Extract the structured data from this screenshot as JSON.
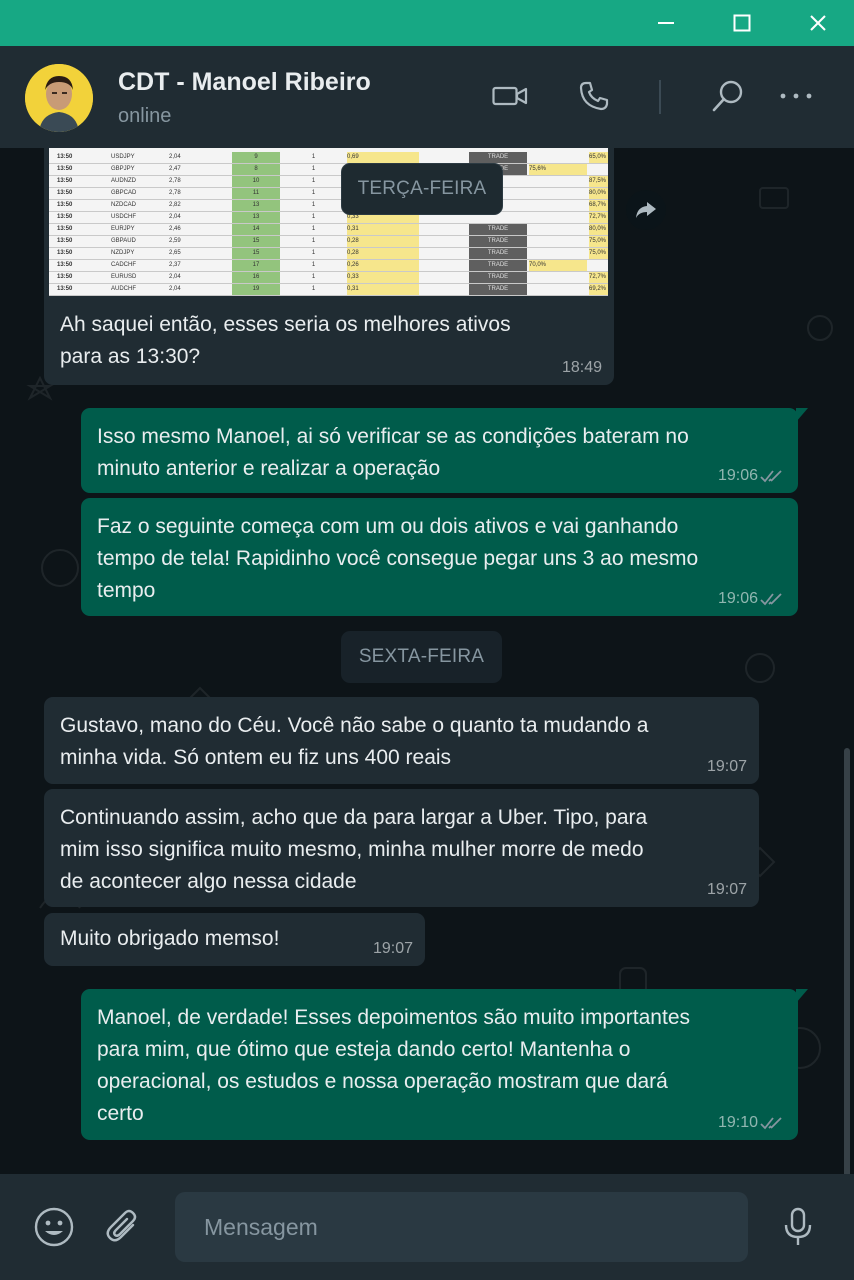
{
  "window": {
    "controls": [
      "minimize-icon",
      "maximize-icon",
      "close-icon"
    ],
    "accent_color": "#17a884"
  },
  "header": {
    "contact_name": "CDT - Manoel Ribeiro",
    "status": "online",
    "icons": [
      "video-call-icon",
      "phone-icon",
      "search-icon",
      "menu-dots-icon"
    ]
  },
  "chat": {
    "colors": {
      "incoming_bg": "#202c33",
      "outgoing_bg": "#005c4b",
      "background": "#0d1418"
    },
    "image_message": {
      "caption_line_1": "Ah saquei então, esses seria os melhores ativos",
      "caption_line_2": "para as 13:30?",
      "time": "18:49",
      "sheet_rows": [
        {
          "time": "13:50",
          "asset": "USDJPY",
          "val": "2,04",
          "n": "9",
          "one": "1",
          "pct": "0,69",
          "trade": "TRADE",
          "res": "",
          "score": "65,0%"
        },
        {
          "time": "13:50",
          "asset": "GBPJPY",
          "val": "2,47",
          "n": "8",
          "one": "1",
          "pct": "0,47",
          "trade": "TRADE",
          "res": "75,6%",
          "score": ""
        },
        {
          "time": "13:50",
          "asset": "AUDNZD",
          "val": "2,78",
          "n": "10",
          "one": "1",
          "pct": "0,47",
          "trade": "",
          "res": "",
          "score": "87,5%"
        },
        {
          "time": "13:50",
          "asset": "GBPCAD",
          "val": "2,78",
          "n": "11",
          "one": "1",
          "pct": "0,45",
          "trade": "",
          "res": "",
          "score": "80,0%"
        },
        {
          "time": "13:50",
          "asset": "NZDCAD",
          "val": "2,82",
          "n": "13",
          "one": "1",
          "pct": "0,33",
          "trade": "",
          "res": "",
          "score": "68,7%"
        },
        {
          "time": "13:50",
          "asset": "USDCHF",
          "val": "2,04",
          "n": "13",
          "one": "1",
          "pct": "0,33",
          "trade": "",
          "res": "",
          "score": "72,7%"
        },
        {
          "time": "13:50",
          "asset": "EURJPY",
          "val": "2,46",
          "n": "14",
          "one": "1",
          "pct": "0,31",
          "trade": "TRADE",
          "res": "",
          "score": "80,0%"
        },
        {
          "time": "13:50",
          "asset": "GBPAUD",
          "val": "2,59",
          "n": "15",
          "one": "1",
          "pct": "0,28",
          "trade": "TRADE",
          "res": "",
          "score": "75,0%"
        },
        {
          "time": "13:50",
          "asset": "NZDJPY",
          "val": "2,65",
          "n": "15",
          "one": "1",
          "pct": "0,28",
          "trade": "TRADE",
          "res": "",
          "score": "75,0%"
        },
        {
          "time": "13:50",
          "asset": "CADCHF",
          "val": "2,37",
          "n": "17",
          "one": "1",
          "pct": "0,26",
          "trade": "TRADE",
          "res": "70,0%",
          "score": ""
        },
        {
          "time": "13:50",
          "asset": "EURUSD",
          "val": "2,04",
          "n": "16",
          "one": "1",
          "pct": "0,33",
          "trade": "TRADE",
          "res": "",
          "score": "72,7%"
        },
        {
          "time": "13:50",
          "asset": "AUDCHF",
          "val": "2,04",
          "n": "19",
          "one": "1",
          "pct": "0,31",
          "trade": "TRADE",
          "res": "",
          "score": "69,2%"
        }
      ]
    },
    "date_1": "TERÇA-FEIRA",
    "msg_out_1": {
      "line_1": "Isso mesmo Manoel, ai só verificar se as condições bateram no",
      "line_2": "minuto anterior e realizar a operação",
      "time": "19:06"
    },
    "msg_out_2": {
      "line_1": "Faz o seguinte começa com um ou dois ativos e vai ganhando",
      "line_2": "tempo de tela! Rapidinho você consegue pegar uns 3 ao mesmo",
      "line_3": "tempo",
      "time": "19:06"
    },
    "date_2": "SEXTA-FEIRA",
    "msg_in_1": {
      "line_1": "Gustavo, mano do Céu. Você não sabe o quanto ta mudando a",
      "line_2": "minha vida. Só ontem eu fiz uns 400 reais",
      "time": "19:07"
    },
    "msg_in_2": {
      "line_1": "Continuando assim, acho que da para largar a Uber. Tipo, para",
      "line_2": "mim isso significa muito mesmo, minha mulher morre de medo",
      "line_3": "de acontecer algo nessa cidade",
      "time": "19:07"
    },
    "msg_in_3": {
      "line_1": "Muito obrigado memso!",
      "time": "19:07"
    },
    "msg_out_3": {
      "line_1": "Manoel, de verdade! Esses depoimentos são muito importantes",
      "line_2": "para mim, que ótimo que esteja dando certo! Mantenha o",
      "line_3": "operacional, os estudos e nossa operação mostram que dará",
      "line_4": "certo",
      "time": "19:10"
    }
  },
  "composer": {
    "placeholder": "Mensagem",
    "icons": [
      "emoji-icon",
      "attach-icon",
      "microphone-icon"
    ]
  }
}
